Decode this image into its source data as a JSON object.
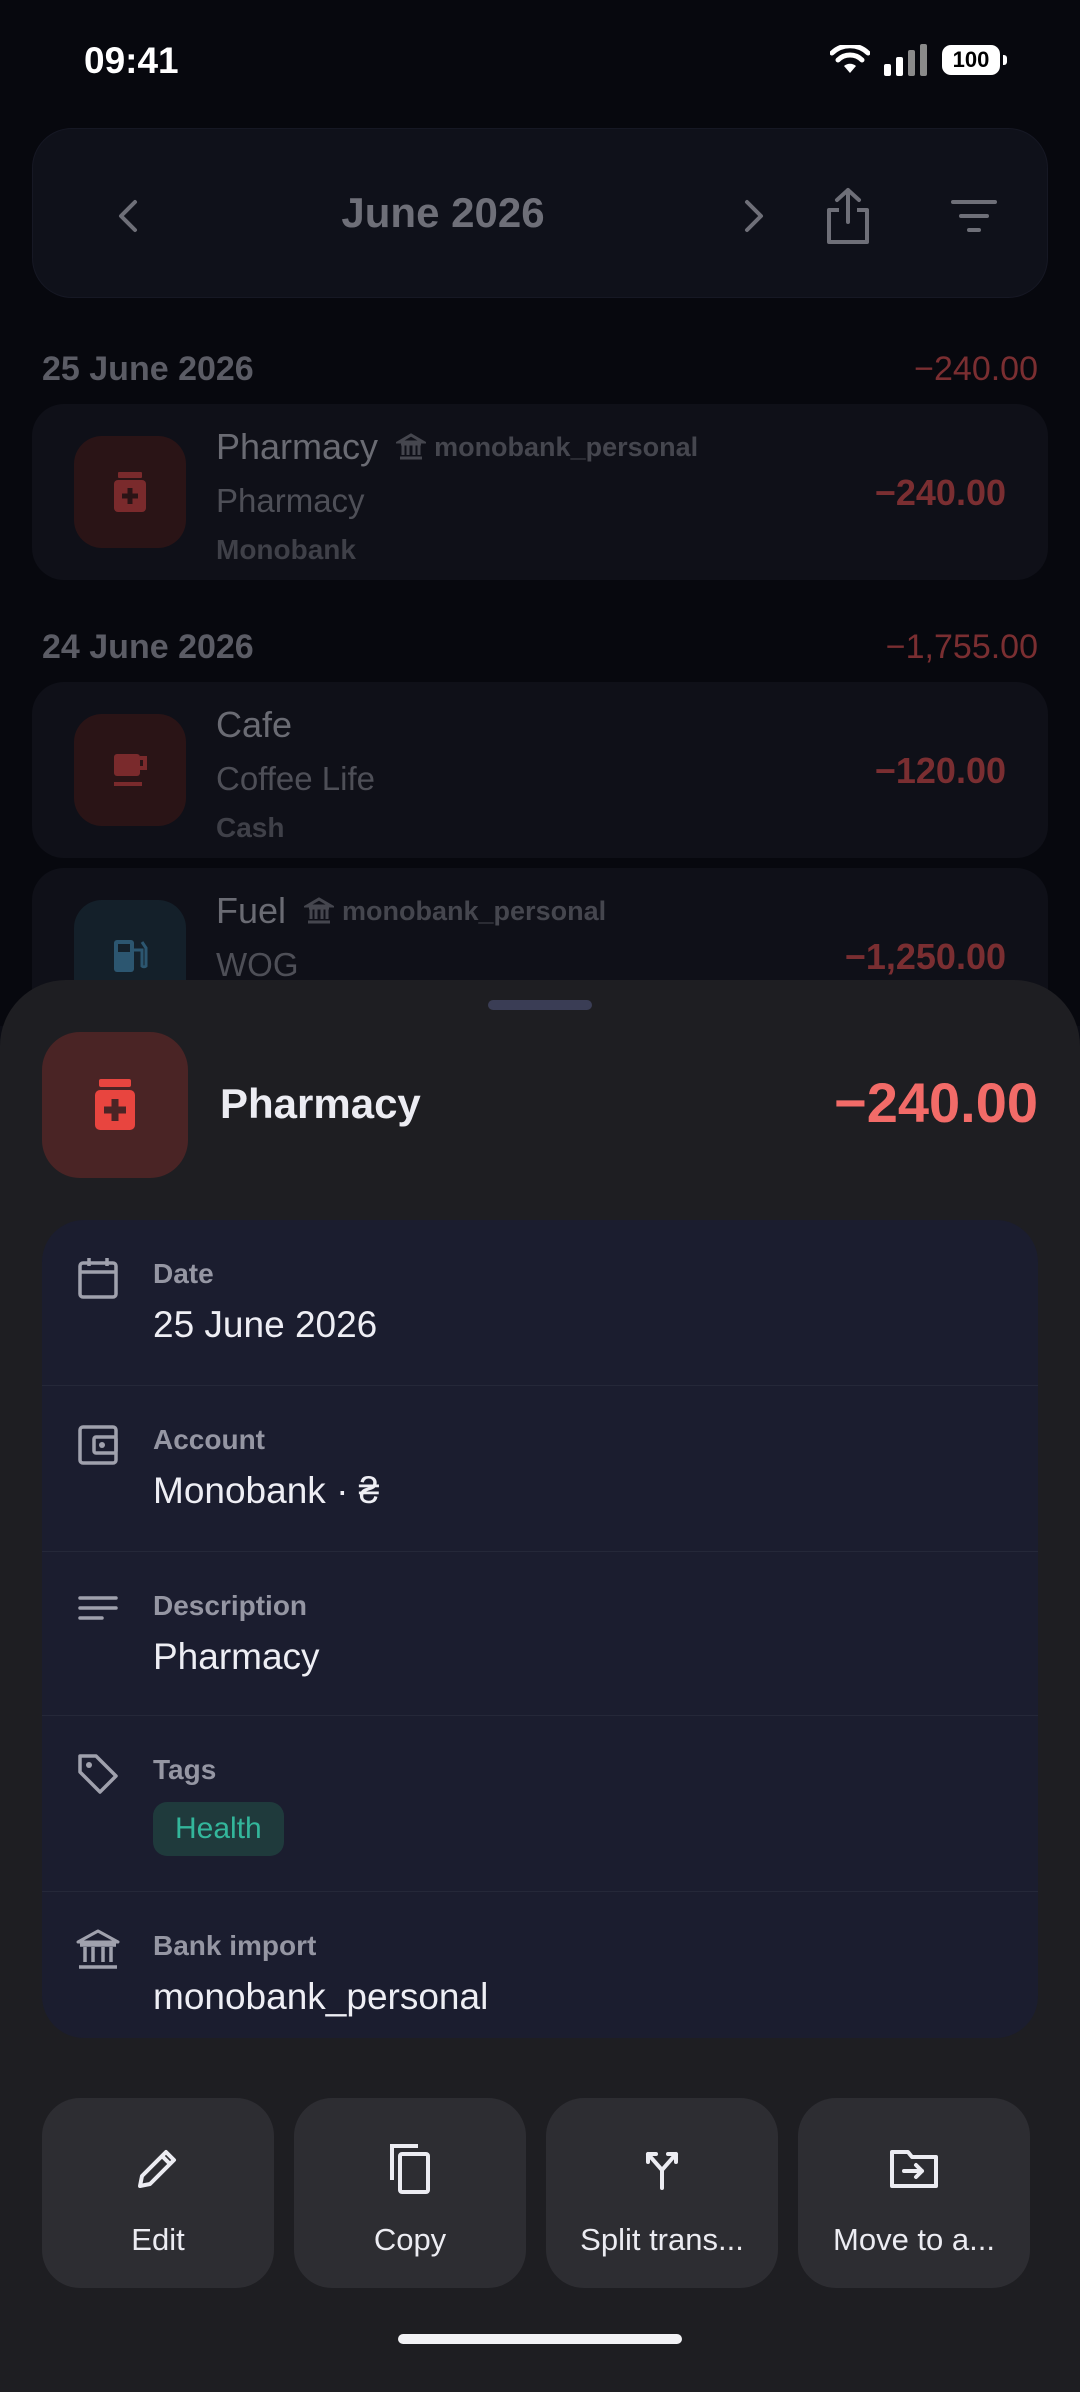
{
  "status_bar": {
    "time": "09:41",
    "battery": "100"
  },
  "header": {
    "month": "June 2026"
  },
  "groups": [
    {
      "date": "25 June 2026",
      "total": "−240.00",
      "items": [
        {
          "category": "Pharmacy",
          "bank": "monobank_personal",
          "description": "Pharmacy",
          "account": "Monobank",
          "amount": "−240.00",
          "icon": "pharmacy-icon"
        }
      ]
    },
    {
      "date": "24 June 2026",
      "total": "−1,755.00",
      "items": [
        {
          "category": "Cafe",
          "bank": "",
          "description": "Coffee Life",
          "account": "Cash",
          "amount": "−120.00",
          "icon": "coffee-cup-icon"
        },
        {
          "category": "Fuel",
          "bank": "monobank_personal",
          "description": "WOG",
          "account": "",
          "amount": "−1,250.00",
          "icon": "fuel-pump-icon"
        }
      ]
    }
  ],
  "sheet": {
    "title": "Pharmacy",
    "amount": "−240.00",
    "amount_color": "#f26b68",
    "details": {
      "date_label": "Date",
      "date_value": "25 June 2026",
      "account_label": "Account",
      "account_value": "Monobank · ₴",
      "description_label": "Description",
      "description_value": "Pharmacy",
      "tags_label": "Tags",
      "tag": "Health",
      "bank_label": "Bank import",
      "bank_value": "monobank_personal"
    },
    "actions": [
      "Edit",
      "Copy",
      "Split trans...",
      "Move to a..."
    ]
  }
}
